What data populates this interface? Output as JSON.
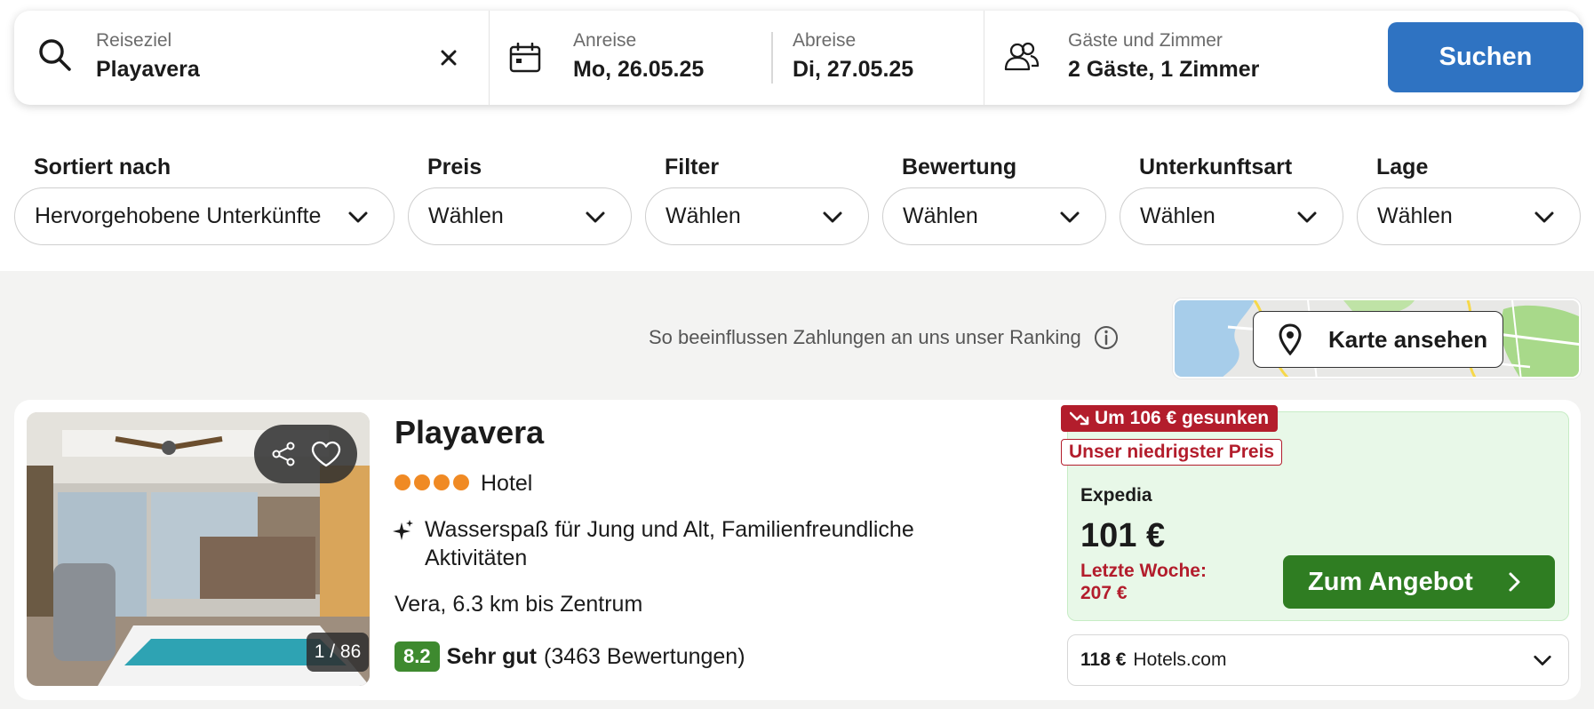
{
  "search": {
    "destination_label": "Reiseziel",
    "destination_value": "Playavera",
    "checkin_label": "Anreise",
    "checkin_value": "Mo, 26.05.25",
    "checkout_label": "Abreise",
    "checkout_value": "Di, 27.05.25",
    "guests_label": "Gäste und Zimmer",
    "guests_value": "2 Gäste, 1 Zimmer",
    "search_button": "Suchen"
  },
  "filters": [
    {
      "label": "Sortiert nach",
      "value": "Hervorgehobene Unterkünfte"
    },
    {
      "label": "Preis",
      "value": "Wählen"
    },
    {
      "label": "Filter",
      "value": "Wählen"
    },
    {
      "label": "Bewertung",
      "value": "Wählen"
    },
    {
      "label": "Unterkunftsart",
      "value": "Wählen"
    },
    {
      "label": "Lage",
      "value": "Wählen"
    }
  ],
  "ranking_info": "So beeinflussen Zahlungen an uns unser Ranking",
  "map_button": "Karte ansehen",
  "result": {
    "photo_counter": "1 / 86",
    "name": "Playavera",
    "star_count": 4,
    "type": "Hotel",
    "feature": "Wasserspaß für Jung und Alt, Familienfreundliche Aktivitäten",
    "distance": "Vera, 6.3 km bis Zentrum",
    "rating_score": "8.2",
    "rating_word": "Sehr gut",
    "rating_count": "(3463 Bewertungen)",
    "deal": {
      "drop_tag": "Um 106 € gesunken",
      "lowest_tag": "Unser niedrigster Preis",
      "provider": "Expedia",
      "price": "101 €",
      "last_week": "Letzte Woche: 207 €",
      "offer_button": "Zum Angebot"
    },
    "alt_offer": {
      "price": "118 €",
      "provider": "Hotels.com"
    }
  },
  "colors": {
    "search_button": "#2f73c2",
    "offer_button": "#2f7d22",
    "rating_badge": "#3e8a2f",
    "price_drop": "#b31d2c",
    "stars": "#f08a24",
    "deal_bg": "#e8f8e8"
  }
}
